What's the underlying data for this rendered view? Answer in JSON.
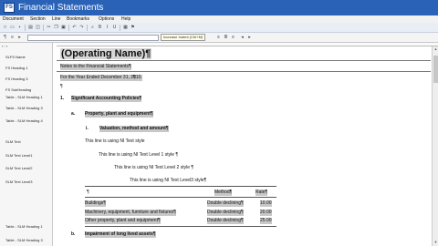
{
  "window": {
    "title": "Financial Statements"
  },
  "menu": [
    "Document",
    "Section",
    "Line",
    "Bookmarks",
    "Options",
    "Help"
  ],
  "tooltip": "Increase Indent (Ctrl+M)",
  "sidebar": {
    "items": [
      "SLFS Name",
      "FS Heading 1",
      "FS Heading 3",
      "FS SubHeading",
      "Table - SLM Heading 1",
      "Table - SLM Heading 3",
      "Table - SLM Heading 4",
      "SLM Text",
      "SLM Text Level1",
      "SLM Text Level2",
      "SLM Text Level3",
      "Table - SLM Heading 1",
      "Table - SLM Heading 3"
    ]
  },
  "document": {
    "op_name": "(Operating Name)¶",
    "notes": "Notes to the Financial Statements¶",
    "year": "For the Year Ended December 31, 2010.",
    "pilcrow_year": "¶",
    "blank": "¶",
    "sec1_num": "1.",
    "sec1_title": "Significant Accounting Policies¶",
    "suba_letter": "a.",
    "suba_title": "Property, plant and equipment¶",
    "subi_num": "i.",
    "subi_title": "Valuation, method and amount¶",
    "text_nt": "This line is using NI Text style",
    "text_l1": "This line is using NI Text Level 1 style ¶",
    "text_l2": "This line is using NI Text Level 2 style ¶",
    "text_l3": "This line  is using NI Text Level3 style¶",
    "table": {
      "headers": [
        "¶",
        "Method¶",
        "Rate¶"
      ],
      "rows": [
        [
          "Buildings¶",
          "Double declining¶",
          "10.00"
        ],
        [
          "Machinery, equipment, furniture and fixtures¶",
          "Double declining¶",
          "20.00"
        ],
        [
          "Other property, plant and equipment¶",
          "Double declining¶",
          "25.00"
        ]
      ]
    },
    "subb_letter": "b.",
    "subb_title": "Impairment of long lived assets¶"
  }
}
